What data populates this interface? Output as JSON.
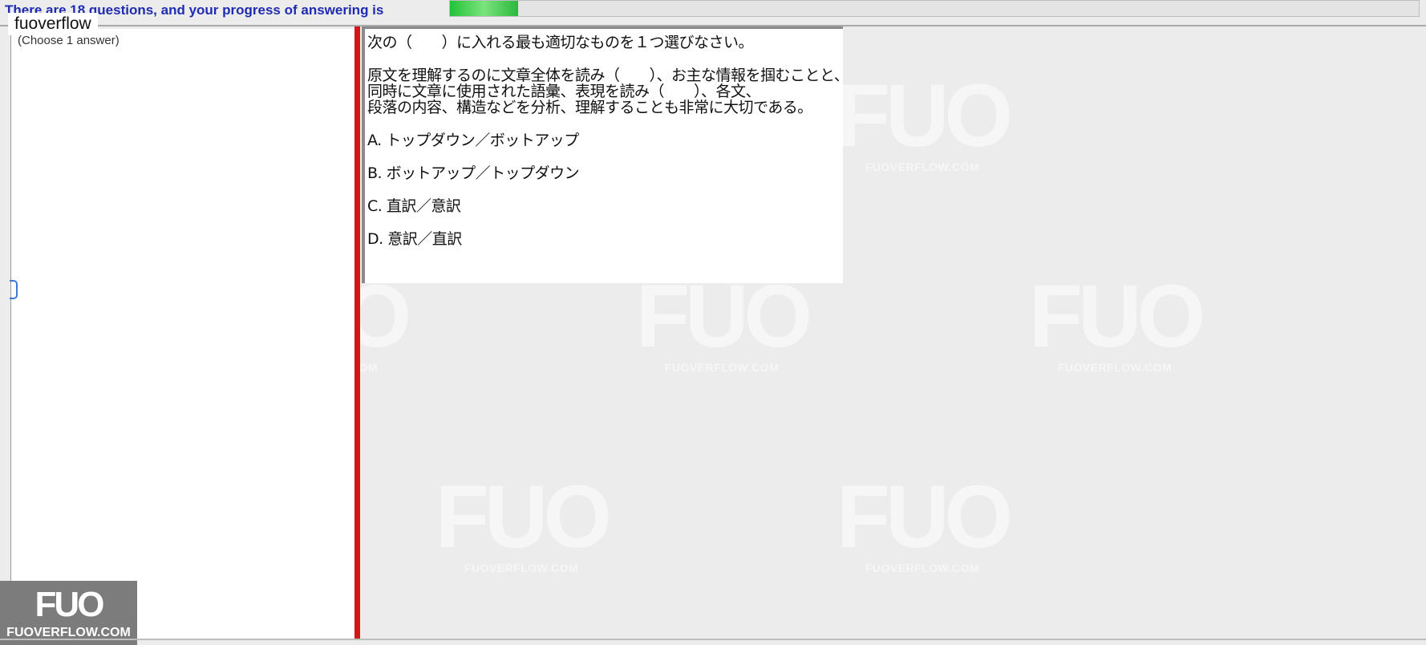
{
  "header": {
    "status_text": "There are 18 questions, and your progress of answering is",
    "progress_fraction": 0.07,
    "progress_color": "#2ec43f"
  },
  "watermark_tag": "fuoverflow",
  "left_panel": {
    "choose_hint": "(Choose 1 answer)"
  },
  "question": {
    "instruction": "次の（　　）に入れる最も適切なものを１つ選びなさい。",
    "body_lines": [
      "原文を理解するのに文章全体を読み（　　）、お主な情報を掴むことと、",
      "同時に文章に使用された語彙、表現を読み（　　）、各文、",
      "段落の内容、構造などを分析、理解することも非常に大切である。"
    ],
    "options": [
      "A.  トップダウン／ボットアップ",
      "B.  ボットアップ／トップダウン",
      "C.  直訳／意訳",
      "D.  意訳／直訳"
    ]
  },
  "watermark": {
    "mark": "FUO",
    "site": "FUOVERFLOW.COM"
  },
  "logo": {
    "mark": "FUO",
    "site": "FUOVERFLOW.COM"
  },
  "colors": {
    "splitter": "#d61518",
    "status_text": "#1f2bb0"
  }
}
